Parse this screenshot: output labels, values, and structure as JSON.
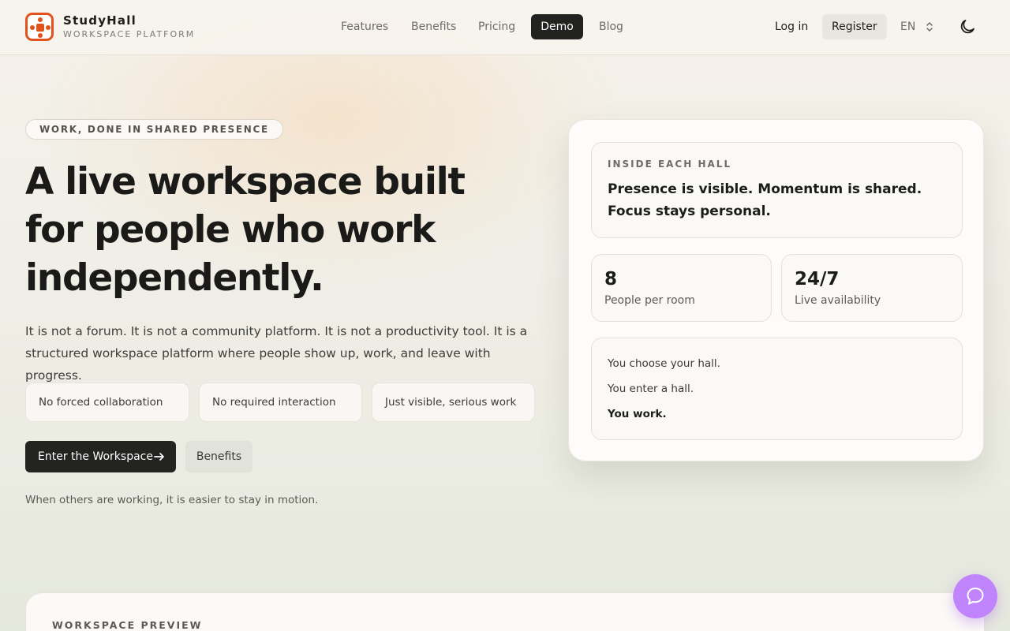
{
  "brand": {
    "name": "StudyHall",
    "tagline": "WORKSPACE PLATFORM",
    "accent": "#e2531c"
  },
  "nav": {
    "items": [
      {
        "label": "Features",
        "active": false
      },
      {
        "label": "Benefits",
        "active": false
      },
      {
        "label": "Pricing",
        "active": false
      },
      {
        "label": "Demo",
        "active": true
      },
      {
        "label": "Blog",
        "active": false
      }
    ],
    "login": "Log in",
    "register": "Register",
    "language": "EN",
    "theme_icon": "moon-icon"
  },
  "hero": {
    "tag": "WORK, DONE IN SHARED PRESENCE",
    "headline": "A live workspace built for people who work independently.",
    "lede": "It is not a forum. It is not a community platform. It is not a productivity tool. It is a structured workspace platform where people show up, work, and leave with progress.",
    "pills": [
      "No forced collaboration",
      "No required interaction",
      "Just visible, serious work"
    ],
    "cta_primary": "Enter the Workspace",
    "cta_secondary": "Benefits",
    "footnote": "When others are working, it is easier to stay in motion."
  },
  "card": {
    "label": "INSIDE EACH HALL",
    "statement": "Presence is visible. Momentum is shared. Focus stays personal.",
    "stats": [
      {
        "value": "8",
        "label": "People per room"
      },
      {
        "value": "24/7",
        "label": "Live availability"
      }
    ],
    "steps": [
      "You choose your hall.",
      "You enter a hall.",
      "You work."
    ]
  },
  "preview": {
    "label": "WORKSPACE PREVIEW"
  },
  "chat": {
    "icon": "chat-bubble-icon",
    "color": "#c084fc"
  }
}
